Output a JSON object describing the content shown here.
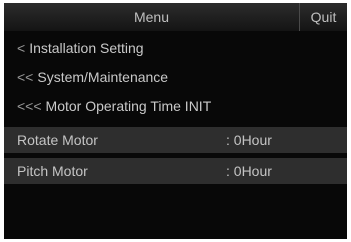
{
  "header": {
    "title": "Menu",
    "quit_label": "Quit"
  },
  "breadcrumbs": [
    {
      "arrows": "<",
      "label": "Installation Setting"
    },
    {
      "arrows": "<<",
      "label": "System/Maintenance"
    },
    {
      "arrows": "<<<",
      "label": "Motor Operating Time INIT"
    }
  ],
  "rows": [
    {
      "label": "Rotate Motor",
      "value": ": 0Hour"
    },
    {
      "label": "Pitch Motor",
      "value": ": 0Hour"
    }
  ],
  "colors": {
    "background": "#080808",
    "row_background": "#2e2e2e",
    "text": "#c4c4c4"
  }
}
